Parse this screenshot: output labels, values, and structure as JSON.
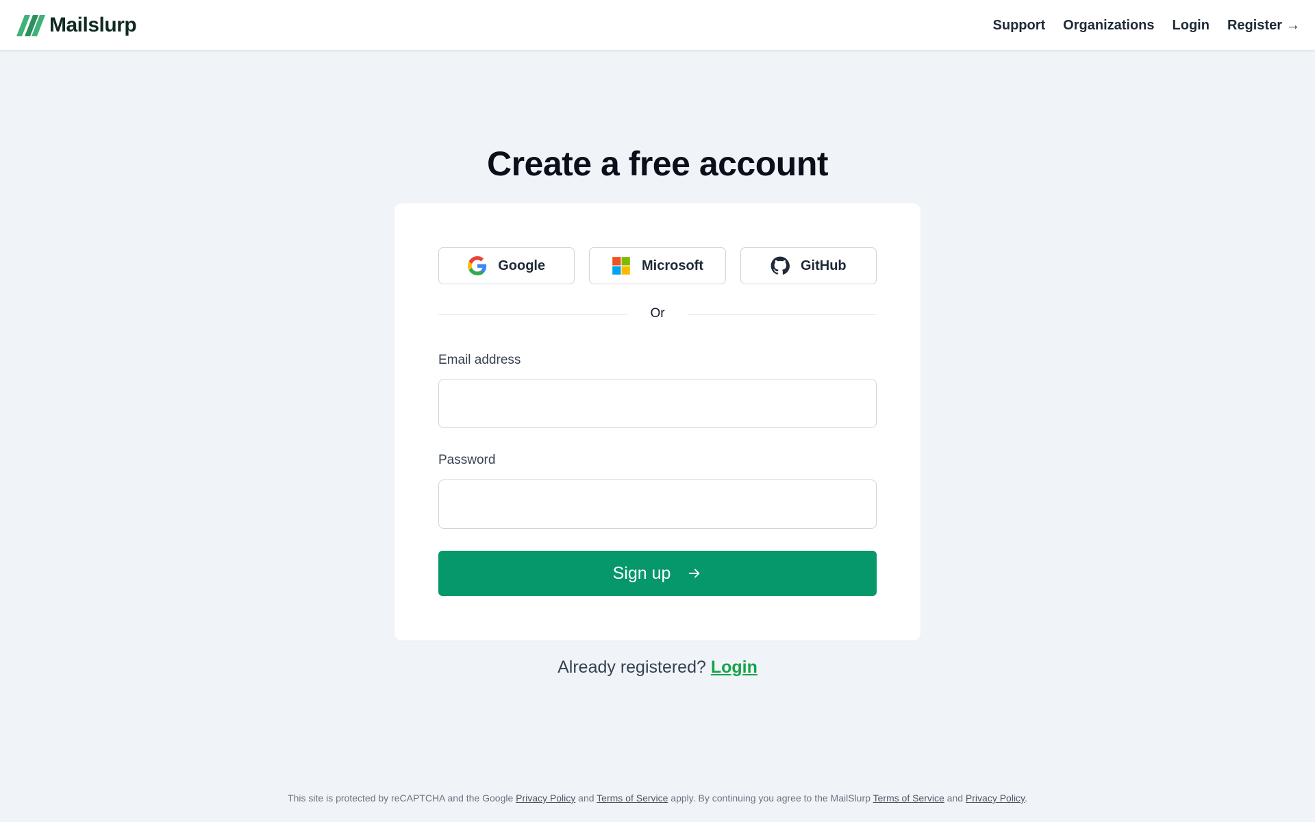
{
  "brand": {
    "name": "Mailslurp"
  },
  "nav": {
    "support": "Support",
    "organizations": "Organizations",
    "login": "Login",
    "register": "Register",
    "register_arrow": "→"
  },
  "page": {
    "title": "Create a free account"
  },
  "oauth": {
    "google": "Google",
    "microsoft": "Microsoft",
    "github": "GitHub"
  },
  "divider": {
    "text": "Or"
  },
  "form": {
    "email_label": "Email address",
    "email_value": "",
    "password_label": "Password",
    "password_value": "",
    "signup_label": "Sign up"
  },
  "already": {
    "text": "Already registered?",
    "link": "Login"
  },
  "footer": {
    "part1": "This site is protected by reCAPTCHA and the Google ",
    "google_privacy": "Privacy Policy",
    "and1": " and ",
    "google_terms": "Terms of Service",
    "part2": " apply. By continuing you agree to the MailSlurp ",
    "ms_terms": "Terms of Service",
    "and2": " and ",
    "ms_privacy": "Privacy Policy",
    "end": "."
  },
  "colors": {
    "accent": "#06976a",
    "link_green": "#16a34a",
    "background": "#f0f4f8"
  }
}
